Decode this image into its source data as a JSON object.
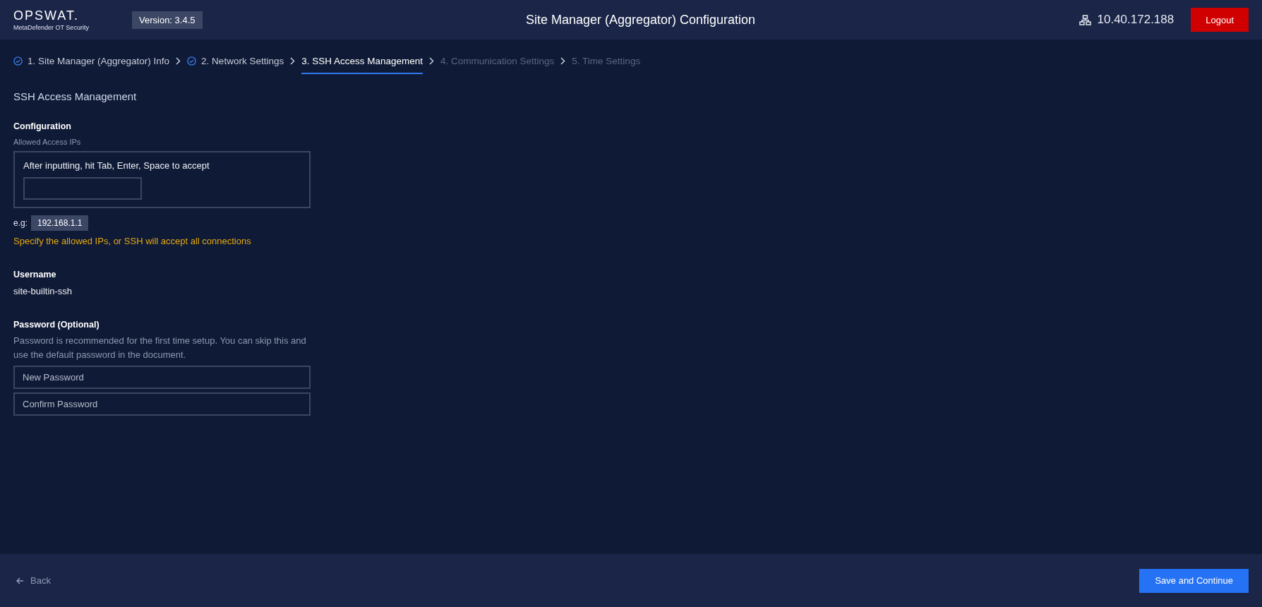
{
  "header": {
    "logo": {
      "name": "OPSWAT.",
      "product": "MetaDefender OT Security"
    },
    "version": "Version: 3.4.5",
    "title": "Site Manager (Aggregator) Configuration",
    "ip": "10.40.172.188",
    "logout": "Logout"
  },
  "steps": [
    {
      "label": "1. Site Manager (Aggregator) Info",
      "completed": true,
      "selected": false,
      "disabled": false
    },
    {
      "label": "2. Network Settings",
      "completed": true,
      "selected": false,
      "disabled": false
    },
    {
      "label": "3. SSH Access Management",
      "completed": false,
      "selected": true,
      "disabled": false
    },
    {
      "label": "4. Communication Settings",
      "completed": false,
      "selected": false,
      "disabled": true
    },
    {
      "label": "5. Time Settings",
      "completed": false,
      "selected": false,
      "disabled": true
    }
  ],
  "section_title": "SSH Access Management",
  "configuration": {
    "heading": "Configuration",
    "label": "Allowed Access IPs",
    "hint": "After inputting, hit Tab, Enter, Space to accept",
    "example_label": "e.g:",
    "example": "192.168.1.1",
    "warning": "Specify the allowed IPs, or SSH will accept all connections"
  },
  "username": {
    "heading": "Username",
    "value": "site-builtin-ssh"
  },
  "password": {
    "heading": "Password (Optional)",
    "description": "Password is recommended for the first time setup. You can skip this and use the default password in the document.",
    "fields": [
      {
        "placeholder": "New Password"
      },
      {
        "placeholder": "Confirm Password"
      }
    ]
  },
  "footer": {
    "back": "Back",
    "save": "Save and Continue"
  }
}
